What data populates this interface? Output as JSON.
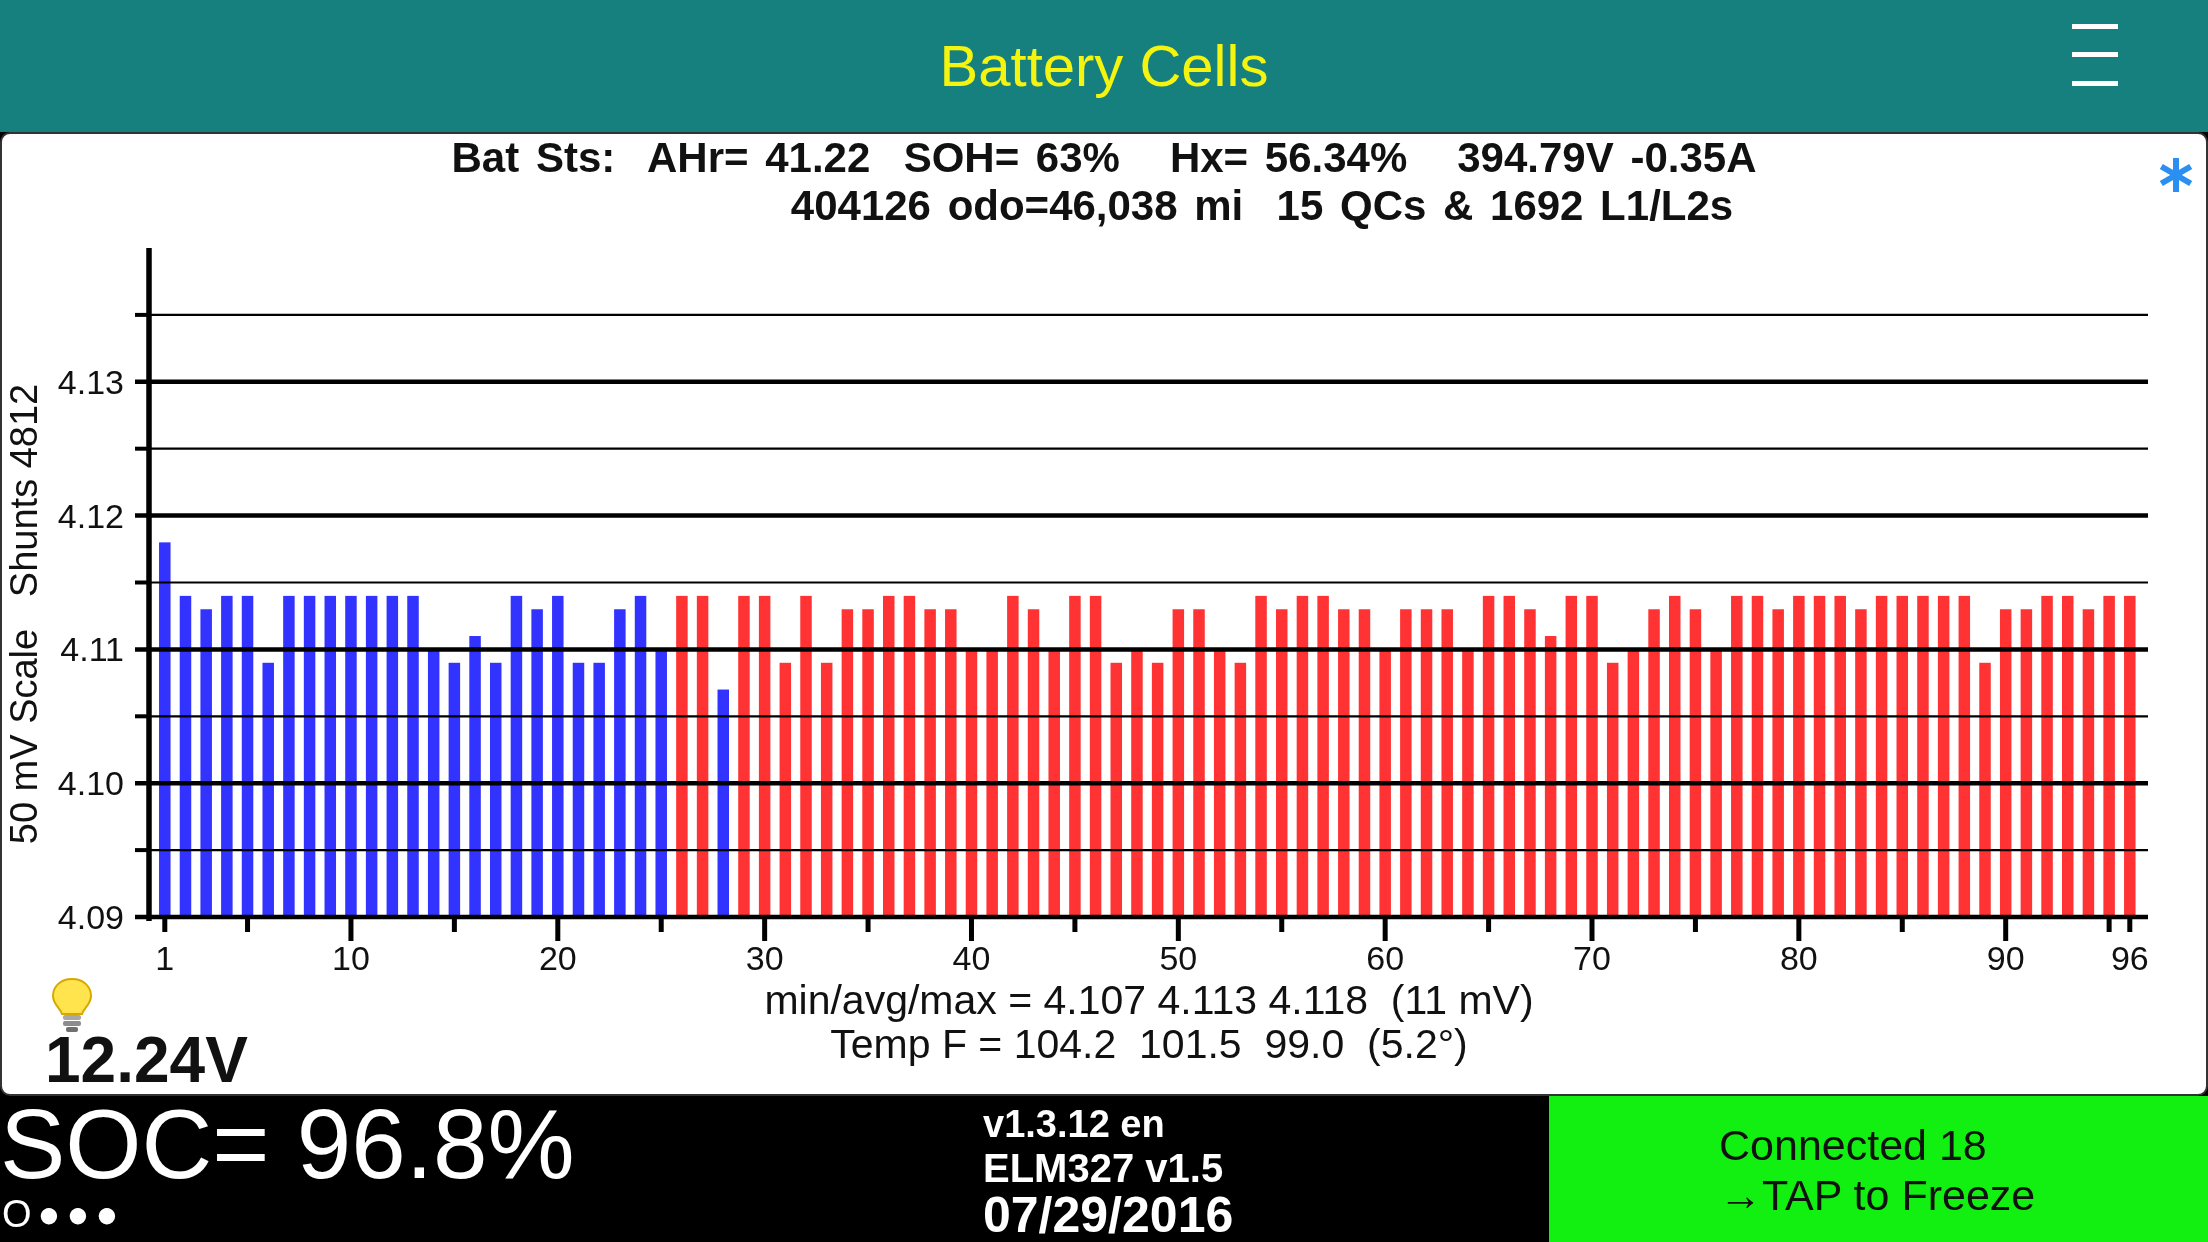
{
  "header": {
    "title": "Battery Cells"
  },
  "battery_status": [
    "Bat Sts:  AHr= 41.22  SOH= 63%   Hx= 56.34%   394.79V -0.35A",
    "404126 odo=46,038 mi  15 QCs & 1692 L1/L2s"
  ],
  "cell_chart": {
    "chart_data": {
      "type": "bar",
      "ylabel": "50 mV Scale   Shunts 4812",
      "grid": true,
      "ylim": [
        4.09,
        4.14
      ],
      "yticks": [
        {
          "value": 4.09,
          "label": "4.09"
        },
        {
          "value": 4.1,
          "label": "4.10"
        },
        {
          "value": 4.11,
          "label": "4.11"
        },
        {
          "value": 4.12,
          "label": "4.12"
        },
        {
          "value": 4.13,
          "label": "4.13"
        }
      ],
      "categories": [
        "1",
        null,
        null,
        null,
        null,
        null,
        null,
        null,
        null,
        "10",
        null,
        null,
        null,
        null,
        null,
        null,
        null,
        null,
        null,
        "20",
        null,
        null,
        null,
        null,
        null,
        null,
        null,
        null,
        null,
        "30",
        null,
        null,
        null,
        null,
        null,
        null,
        null,
        null,
        null,
        "40",
        null,
        null,
        null,
        null,
        null,
        null,
        null,
        null,
        null,
        "50",
        null,
        null,
        null,
        null,
        null,
        null,
        null,
        null,
        null,
        "60",
        null,
        null,
        null,
        null,
        null,
        null,
        null,
        null,
        null,
        "70",
        null,
        null,
        null,
        null,
        null,
        null,
        null,
        null,
        null,
        "80",
        null,
        null,
        null,
        null,
        null,
        null,
        null,
        null,
        null,
        "90",
        null,
        null,
        null,
        null,
        null,
        "96"
      ],
      "values": [
        4.118,
        4.114,
        4.113,
        4.114,
        4.114,
        4.109,
        4.114,
        4.114,
        4.114,
        4.114,
        4.114,
        4.114,
        4.114,
        4.11,
        4.109,
        4.111,
        4.109,
        4.114,
        4.113,
        4.114,
        4.109,
        4.109,
        4.113,
        4.114,
        4.11,
        4.114,
        4.114,
        4.107,
        4.114,
        4.114,
        4.109,
        4.114,
        4.109,
        4.113,
        4.113,
        4.114,
        4.114,
        4.113,
        4.113,
        4.11,
        4.11,
        4.114,
        4.113,
        4.11,
        4.114,
        4.114,
        4.109,
        4.11,
        4.109,
        4.113,
        4.113,
        4.11,
        4.109,
        4.114,
        4.113,
        4.114,
        4.114,
        4.113,
        4.113,
        4.11,
        4.113,
        4.113,
        4.113,
        4.11,
        4.114,
        4.114,
        4.113,
        4.111,
        4.114,
        4.114,
        4.109,
        4.11,
        4.113,
        4.114,
        4.113,
        4.11,
        4.114,
        4.114,
        4.113,
        4.114,
        4.114,
        4.114,
        4.113,
        4.114,
        4.114,
        4.114,
        4.114,
        4.114,
        4.109,
        4.113,
        4.113,
        4.114,
        4.114,
        4.113,
        4.114,
        4.114
      ],
      "colors": [
        "#3333ff",
        "#3333ff",
        "#3333ff",
        "#3333ff",
        "#3333ff",
        "#3333ff",
        "#3333ff",
        "#3333ff",
        "#3333ff",
        "#3333ff",
        "#3333ff",
        "#3333ff",
        "#3333ff",
        "#3333ff",
        "#3333ff",
        "#3333ff",
        "#3333ff",
        "#3333ff",
        "#3333ff",
        "#3333ff",
        "#3333ff",
        "#3333ff",
        "#3333ff",
        "#3333ff",
        "#3333ff",
        "#ff3333",
        "#ff3333",
        "#3333ff",
        "#ff3333",
        "#ff3333",
        "#ff3333",
        "#ff3333",
        "#ff3333",
        "#ff3333",
        "#ff3333",
        "#ff3333",
        "#ff3333",
        "#ff3333",
        "#ff3333",
        "#ff3333",
        "#ff3333",
        "#ff3333",
        "#ff3333",
        "#ff3333",
        "#ff3333",
        "#ff3333",
        "#ff3333",
        "#ff3333",
        "#ff3333",
        "#ff3333",
        "#ff3333",
        "#ff3333",
        "#ff3333",
        "#ff3333",
        "#ff3333",
        "#ff3333",
        "#ff3333",
        "#ff3333",
        "#ff3333",
        "#ff3333",
        "#ff3333",
        "#ff3333",
        "#ff3333",
        "#ff3333",
        "#ff3333",
        "#ff3333",
        "#ff3333",
        "#ff3333",
        "#ff3333",
        "#ff3333",
        "#ff3333",
        "#ff3333",
        "#ff3333",
        "#ff3333",
        "#ff3333",
        "#ff3333",
        "#ff3333",
        "#ff3333",
        "#ff3333",
        "#ff3333",
        "#ff3333",
        "#ff3333",
        "#ff3333",
        "#ff3333",
        "#ff3333",
        "#ff3333",
        "#ff3333",
        "#ff3333",
        "#ff3333",
        "#ff3333",
        "#ff3333",
        "#ff3333",
        "#ff3333",
        "#ff3333",
        "#ff3333",
        "#ff3333"
      ]
    }
  },
  "cell_summary": [
    "min/avg/max = 4.107 4.113 4.118  (11 mV)",
    "Temp F = 104.2  101.5  99.0  (5.2°)"
  ],
  "aux_battery": {
    "voltage": "12.24V"
  },
  "footer": {
    "soc": "SOC= 96.8%",
    "activity": "O●●●",
    "version": "v1.3.12 en",
    "adapter": "ELM327 v1.5",
    "date": "07/29/2016",
    "connection": {
      "status": "Connected 18",
      "action": "→TAP to Freeze"
    }
  }
}
